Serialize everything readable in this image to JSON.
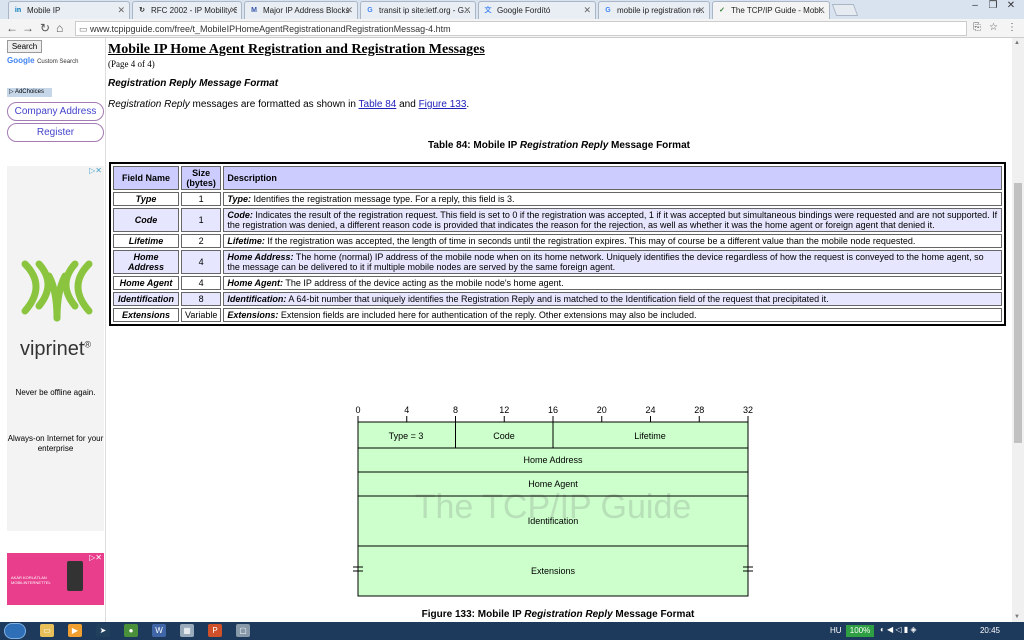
{
  "tabs": [
    {
      "label": "Mobile IP",
      "icon": "in",
      "color": "#0077b5"
    },
    {
      "label": "RFC 2002 - IP Mobility S...",
      "icon": "↻",
      "color": "#333333"
    },
    {
      "label": "Major IP Address Blocks",
      "icon": "M",
      "color": "#3355aa"
    },
    {
      "label": "transit ip site:ietf.org - G...",
      "icon": "G",
      "color": "#4285f4"
    },
    {
      "label": "Google Fordító",
      "icon": "文",
      "color": "#4285f4"
    },
    {
      "label": "mobile ip registration re...",
      "icon": "G",
      "color": "#4285f4"
    },
    {
      "label": "The TCP/IP Guide - Mobi...",
      "icon": "✓",
      "color": "#2e7d32"
    }
  ],
  "url": "www.tcpipguide.com/free/t_MobileIPHomeAgentRegistrationandRegistrationMessag-4.htm",
  "sidebar": {
    "search_label": "Search",
    "google_label": "Google",
    "custom_search": "Custom Search",
    "adchoices": "AdChoices",
    "pill1": "Company Address",
    "pill2": "Register",
    "ad_brand": "viprinet",
    "ad_tag1": "Never be offline again.",
    "ad_tag2": "Always-on Internet for your enterprise",
    "ad2_text": "AKÁR KORLÁTLAN MOBILINTERNETTEL"
  },
  "page": {
    "title": "Mobile IP Home Agent Registration and Registration Messages",
    "page_of": "(Page 4 of 4)",
    "section": "Registration Reply Message Format",
    "intro_em": "Registration Reply",
    "intro_text": " messages are formatted as shown in ",
    "intro_link1": "Table 84",
    "intro_and": " and ",
    "intro_link2": "Figure 133",
    "intro_end": ".",
    "table_caption_a": "Table 84: Mobile IP ",
    "table_caption_em": "Registration Reply",
    "table_caption_b": " Message Format",
    "figure_caption_a": "Figure 133: Mobile IP ",
    "figure_caption_em": "Registration Reply",
    "figure_caption_b": " Message Format"
  },
  "table": {
    "headers": [
      "Field Name",
      "Size (bytes)",
      "Description"
    ],
    "rows": [
      {
        "name": "Type",
        "size": "1",
        "bold": "Type:",
        "desc": " Identifies the registration message type. For a reply, this field is 3."
      },
      {
        "name": "Code",
        "size": "1",
        "bold": "Code:",
        "desc": " Indicates the result of the registration request. This field is set to 0 if the registration was accepted, 1 if it was accepted but simultaneous bindings were requested and are not supported. If the registration was denied, a different reason code is provided that indicates the reason for the rejection, as well as whether it was the home agent or foreign agent that denied it."
      },
      {
        "name": "Lifetime",
        "size": "2",
        "bold": "Lifetime:",
        "desc": " If the registration was accepted, the length of time in seconds until the registration expires. This may of course be a different value than the mobile node requested."
      },
      {
        "name": "Home Address",
        "size": "4",
        "bold": "Home Address:",
        "desc": " The home (normal) IP address of the mobile node when on its home network. Uniquely identifies the device regardless of how the request is conveyed to the home agent, so the message can be delivered to it if multiple mobile nodes are served by the same foreign agent."
      },
      {
        "name": "Home Agent",
        "size": "4",
        "bold": "Home Agent:",
        "desc": " The IP address of the device acting as the mobile node's home agent."
      },
      {
        "name": "Identification",
        "size": "8",
        "bold": "Identification:",
        "desc": " A 64-bit number that uniquely identifies the Registration Reply and is matched to the Identification field of the request that precipitated it."
      },
      {
        "name": "Extensions",
        "size": "Variable",
        "bold": "Extensions:",
        "desc": " Extension fields are included here for authentication of the reply. Other extensions may also be included."
      }
    ]
  },
  "diagram": {
    "bit_labels": [
      "0",
      "4",
      "8",
      "12",
      "16",
      "20",
      "24",
      "28",
      "32"
    ],
    "fields": [
      "Type = 3",
      "Code",
      "Lifetime",
      "Home Address",
      "Home Agent",
      "Identification",
      "Extensions"
    ],
    "watermark": "The TCP/IP Guide",
    "fill": "#ccffcc"
  },
  "taskbar": {
    "lang": "HU",
    "battery": "100%",
    "clock": "20:45"
  }
}
